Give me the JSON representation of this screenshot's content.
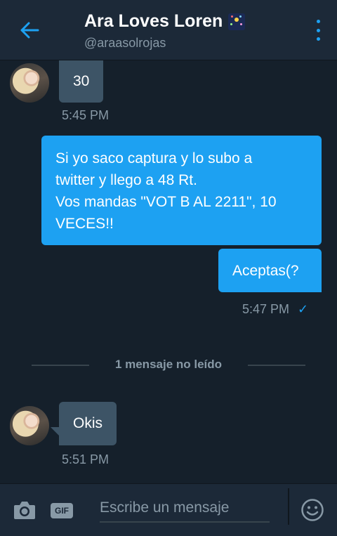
{
  "header": {
    "title": "Ara Loves Loren",
    "title_emoji": "fireworks-emoji",
    "handle": "@araasolrojas",
    "back_icon": "back-arrow-icon",
    "menu_icon": "more-vertical-icon"
  },
  "messages": [
    {
      "direction": "in",
      "text": "30",
      "time": "5:45 PM"
    },
    {
      "direction": "out",
      "lines": [
        "Si yo saco captura y lo subo a",
        "twitter y llego a 48 Rt.",
        "Vos mandas \"VOT B AL 2211\", 10",
        "VECES!!"
      ]
    },
    {
      "direction": "out",
      "text": "Aceptas(?",
      "time": "5:47 PM",
      "status": "✓"
    },
    {
      "direction": "in",
      "text": "Okis",
      "time": "5:51 PM"
    }
  ],
  "unread_divider": "1 mensaje no leído",
  "composer": {
    "placeholder": "Escribe un mensaje",
    "gif_label": "GIF",
    "camera_icon": "camera-icon",
    "emoji_icon": "smiley-icon"
  },
  "colors": {
    "background": "#15202b",
    "header": "#1c2938",
    "incoming_bubble": "#3d5466",
    "outgoing_bubble": "#1da1f2",
    "accent": "#1da1f2",
    "muted_text": "#8899a6"
  }
}
